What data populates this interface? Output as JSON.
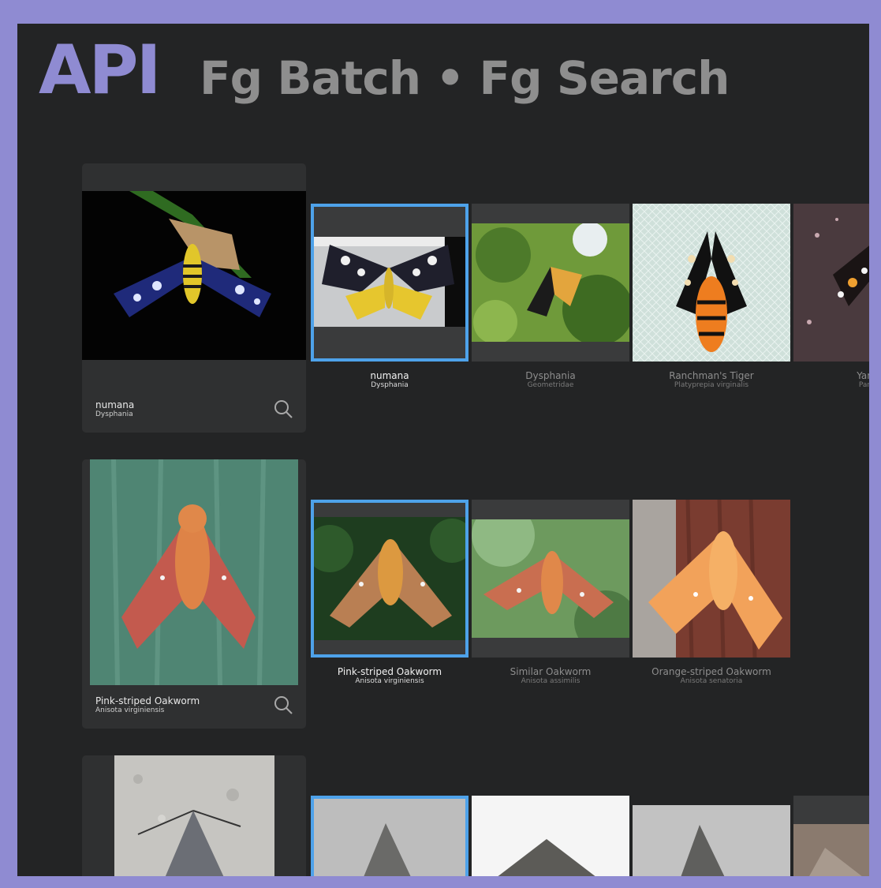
{
  "header": {
    "api": "API",
    "rest": "Fg Batch • Fg Search"
  },
  "icons": {
    "search": "search-icon"
  },
  "colors": {
    "frame": "#8f8bd2",
    "background": "#232425",
    "card": "#2f3031",
    "selected_border": "#4ea2ea"
  },
  "rows": [
    {
      "query": {
        "name": "numana",
        "sci": "Dysphania"
      },
      "results": [
        {
          "name": "numana",
          "sci": "Dysphania"
        },
        {
          "name": "Dysphania",
          "sci": "Geometridae"
        },
        {
          "name": "Ranchman's Tiger",
          "sci": "Platyprepia virginalis"
        },
        {
          "name": "Yarrow",
          "sci": "Pararcti"
        }
      ]
    },
    {
      "query": {
        "name": "Pink-striped Oakworm",
        "sci": "Anisota virginiensis"
      },
      "results": [
        {
          "name": "Pink-striped Oakworm",
          "sci": "Anisota virginiensis"
        },
        {
          "name": "Similar Oakworm",
          "sci": "Anisota assimilis"
        },
        {
          "name": "Orange-striped Oakworm",
          "sci": "Anisota senatoria"
        }
      ]
    }
  ]
}
